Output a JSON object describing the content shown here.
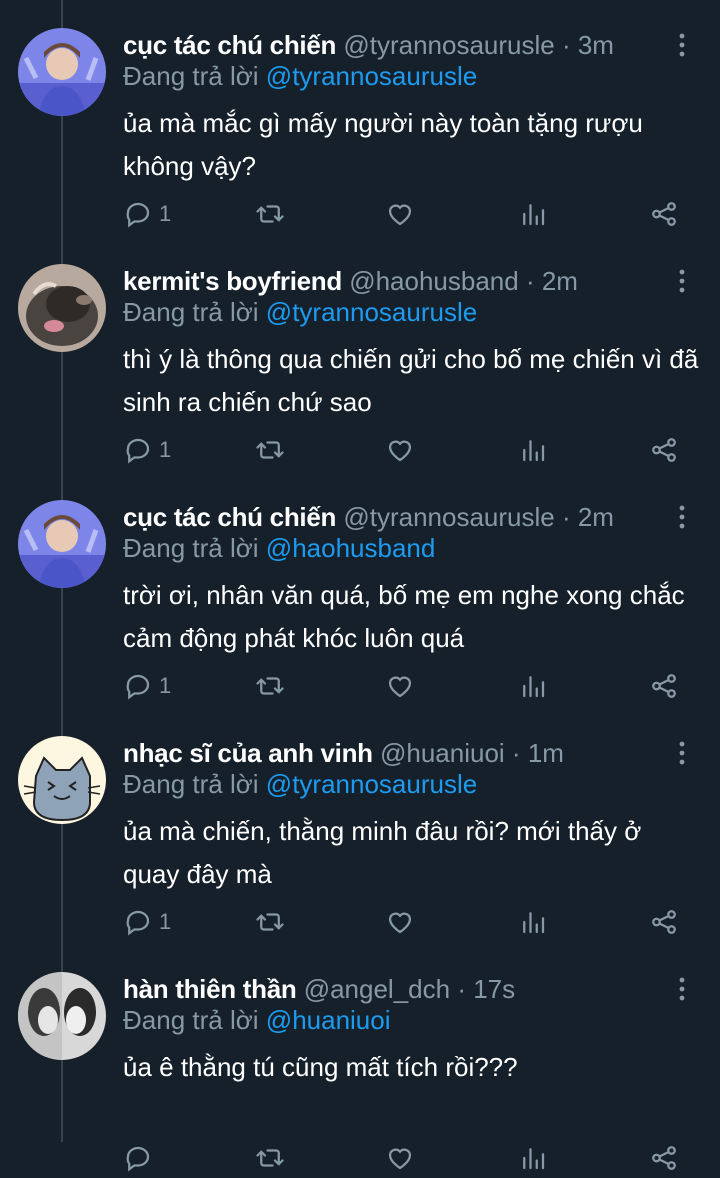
{
  "colors": {
    "background": "#15202b",
    "secondary": "#8899a6",
    "accent": "#1d9bf0",
    "thread_line": "#38444d"
  },
  "reply_prefix": "Đang trả lời",
  "tweets": [
    {
      "name": "cục tác chú chiến",
      "handle": "@tyrannosaurusle",
      "time": "3m",
      "replying_to": "@tyrannosaurusle",
      "text": "ủa mà mắc gì mấy người này toàn tặng rượu không vậy?",
      "reply_count": "1",
      "avatar": "person-blue-avatar"
    },
    {
      "name": "kermit's boyfriend",
      "handle": "@haohusband",
      "time": "2m",
      "replying_to": "@tyrannosaurusle",
      "text": "thì ý là thông qua chiến gửi cho bố mẹ chiến vì đã sinh ra chiến chứ sao",
      "reply_count": "1",
      "avatar": "blurry-cat-avatar"
    },
    {
      "name": "cục tác chú chiến",
      "handle": "@tyrannosaurusle",
      "time": "2m",
      "replying_to": "@haohusband",
      "text": "trời ơi, nhân văn quá, bố mẹ em nghe xong chắc cảm động phát khóc luôn quá",
      "reply_count": "1",
      "avatar": "person-blue-avatar"
    },
    {
      "name": "nhạc sĩ của anh vinh",
      "handle": "@huaniuoi",
      "time": "1m",
      "replying_to": "@tyrannosaurusle",
      "text": "ủa mà chiến, thằng minh đâu rồi? mới thấy ở quay đây mà",
      "reply_count": "1",
      "avatar": "cartoon-cat-avatar"
    },
    {
      "name": "hàn thiên thần",
      "handle": "@angel_dch",
      "time": "17s",
      "replying_to": "@huaniuoi",
      "text": "ủa ê thằng tú cũng mất tích rồi???",
      "reply_count": "",
      "avatar": "grayscale-couple-avatar"
    }
  ]
}
